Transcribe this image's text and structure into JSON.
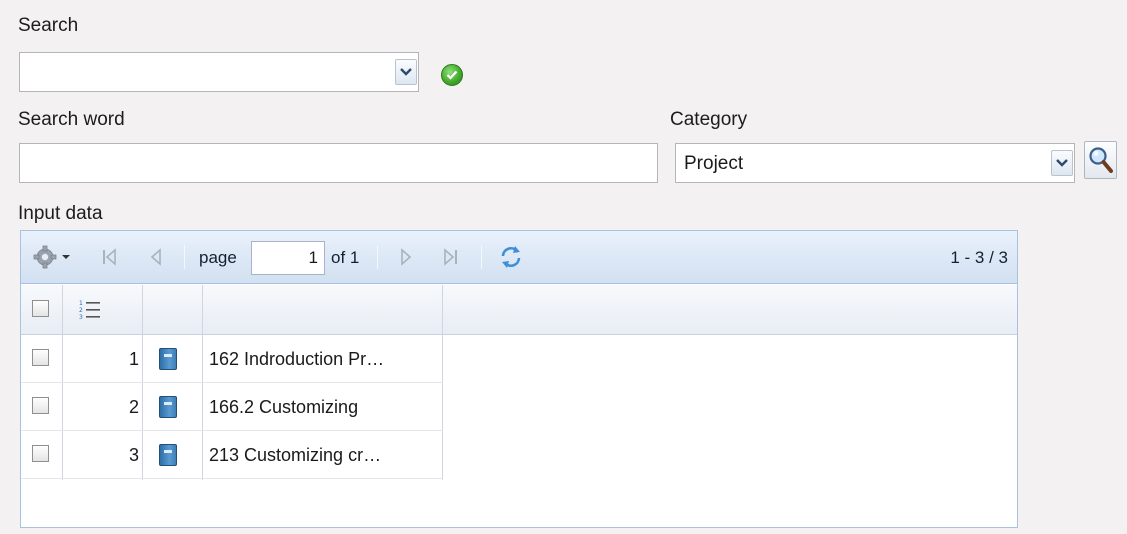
{
  "search": {
    "label": "Search",
    "value": "",
    "apply_icon": "check-circle-icon"
  },
  "search_word": {
    "label": "Search word",
    "value": ""
  },
  "category": {
    "label": "Category",
    "value": "Project",
    "search_icon": "magnifier-icon"
  },
  "input_data": {
    "label": "Input data",
    "pager": {
      "page_label": "page",
      "page_value": "1",
      "of_label": "of 1",
      "summary": "1 - 3 / 3",
      "icons": [
        "gear-icon",
        "first-page-icon",
        "prev-page-icon",
        "next-page-icon",
        "last-page-icon",
        "refresh-icon"
      ]
    },
    "columns": [
      "select-all",
      "row-number",
      "type",
      "name"
    ],
    "rows": [
      {
        "num": "1",
        "title": "162 Indroduction Pr…",
        "icon": "book-icon"
      },
      {
        "num": "2",
        "title": "166.2 Customizing",
        "icon": "book-icon"
      },
      {
        "num": "3",
        "title": "213 Customizing cr…",
        "icon": "book-icon"
      }
    ]
  }
}
